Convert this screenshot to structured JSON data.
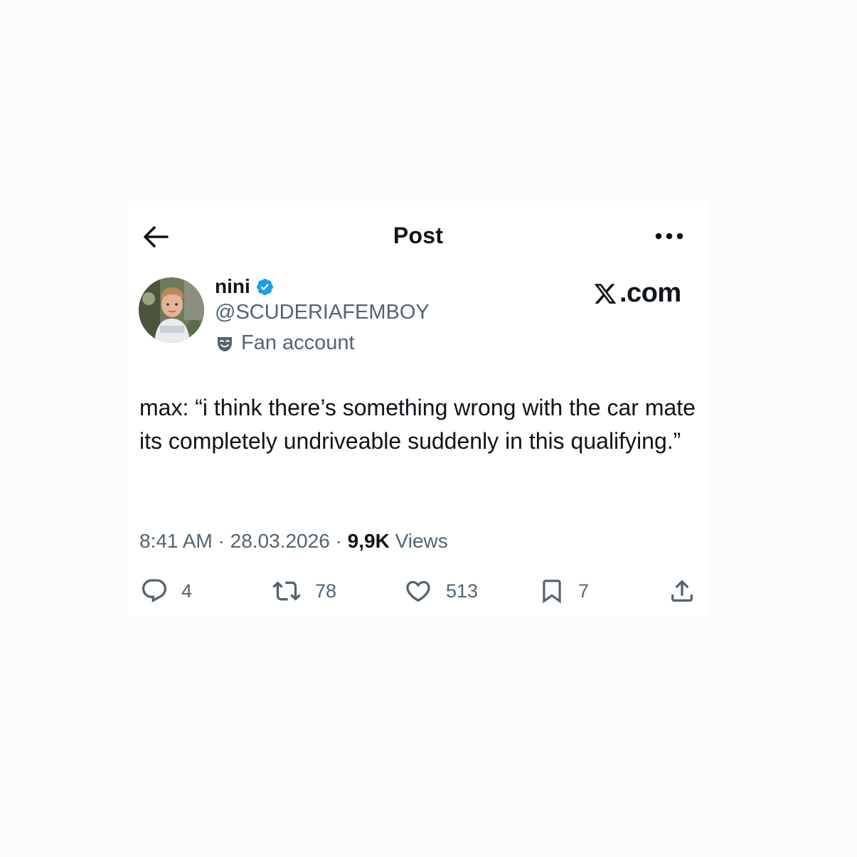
{
  "header": {
    "title": "Post",
    "back_icon": "arrow-left-icon",
    "more_icon": "more-horizontal-icon"
  },
  "author": {
    "display_name": "nini",
    "handle": "@SCUDERIAFEMBOY",
    "label": "Fan account",
    "verified_icon": "verified-badge-icon",
    "label_icon": "theater-masks-icon",
    "accent_color": "#1d9bf0"
  },
  "brand": {
    "suffix": ".com",
    "icon": "x-logo-icon"
  },
  "post": {
    "text": "max: “i think there’s something wrong with the car mate its completely undriveable suddenly in this qualifying.”"
  },
  "meta": {
    "time": "8:41 AM",
    "separator": "·",
    "date": "28.03.2026",
    "views_count": "9,9K",
    "views_label": "Views"
  },
  "actions": {
    "replies": "4",
    "reposts": "78",
    "likes": "513",
    "bookmarks": "7"
  },
  "colors": {
    "text": "#0f1419",
    "secondary": "#536471",
    "background": "#fbfbfb",
    "card": "#ffffff"
  }
}
